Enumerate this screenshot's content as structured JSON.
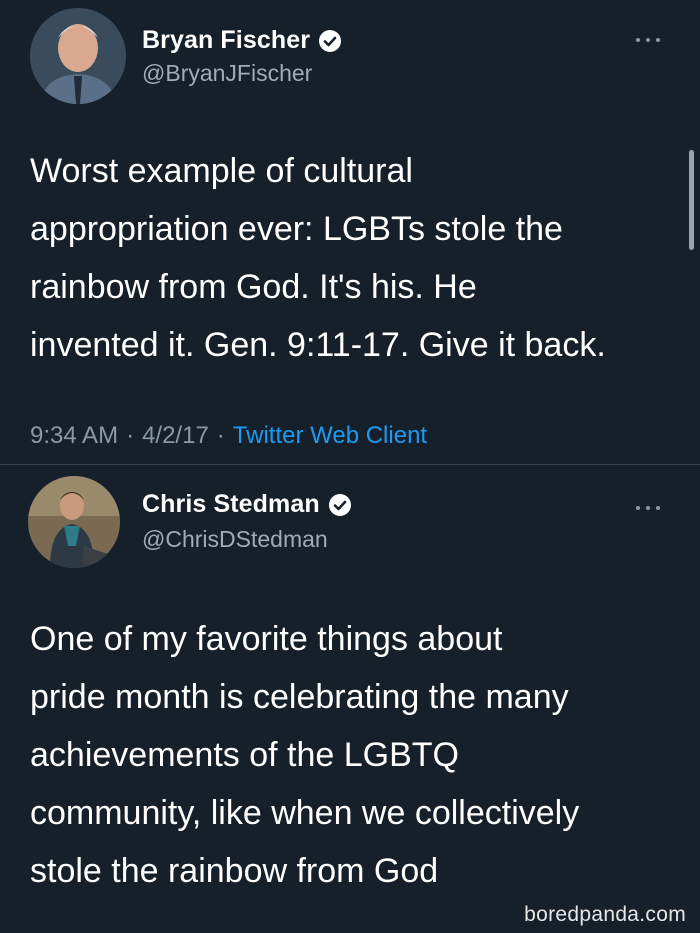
{
  "tweet1": {
    "display_name": "Bryan Fischer",
    "handle": "@BryanJFischer",
    "text": "Worst example of cultural\nappropriation ever: LGBTs stole the\nrainbow from God. It's his. He\ninvented it. Gen. 9:11-17. Give it back.",
    "time": "9:34 AM",
    "sep1": "·",
    "date": "4/2/17",
    "sep2": "·",
    "client": "Twitter Web Client",
    "icons": {
      "verified": "verified-badge-icon",
      "more": "more-options-icon"
    }
  },
  "tweet2": {
    "display_name": "Chris Stedman",
    "handle": "@ChrisDStedman",
    "text": "One of my favorite things about\npride month is celebrating the many\nachievements of the LGBTQ\ncommunity, like when we collectively\nstole the rainbow from God",
    "icons": {
      "verified": "verified-badge-icon",
      "more": "more-options-icon"
    }
  },
  "watermark": "boredpanda.com",
  "colors": {
    "background": "#15202b",
    "link": "#1d9bf0",
    "secondary_text": "#8b98a5",
    "divider": "#38444d"
  }
}
